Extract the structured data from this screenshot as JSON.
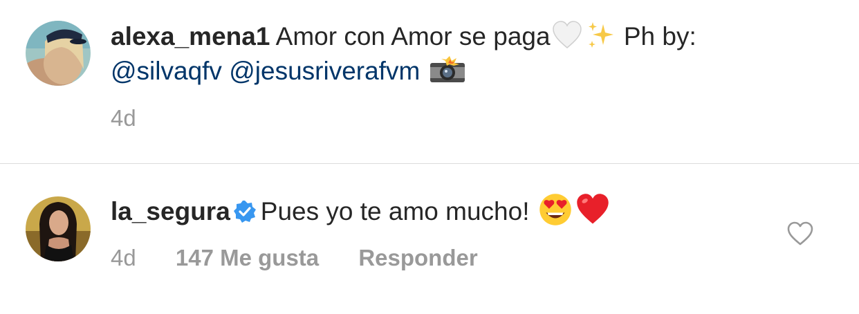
{
  "caption": {
    "username": "alexa_mena1",
    "text": "Amor con Amor se paga",
    "text_after_emojis": "Ph by:",
    "mentions": [
      "@silvaqfv",
      "@jesusriverafvm"
    ],
    "emojis": [
      "white-heart-icon",
      "sparkles-icon",
      "camera-flash-icon"
    ],
    "time": "4d"
  },
  "comment": {
    "username": "la_segura",
    "verified": true,
    "text": "Pues yo te amo mucho!",
    "emojis": [
      "heart-eyes-face-icon",
      "red-heart-icon"
    ],
    "time": "4d",
    "likes_label": "147 Me gusta",
    "reply_label": "Responder"
  },
  "colors": {
    "text": "#262626",
    "mention": "#003569",
    "meta": "#999999",
    "verified": "#3897f0",
    "divider": "#dbdbdb"
  }
}
